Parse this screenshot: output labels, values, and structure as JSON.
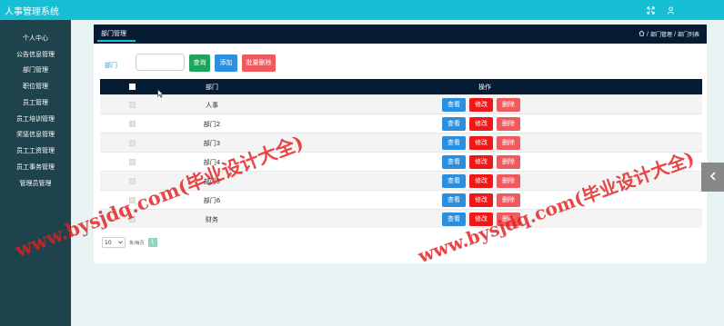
{
  "app": {
    "title": "人事管理系统"
  },
  "topbar": {
    "fullscreen_icon": "expand-icon",
    "user_icon": "user-icon"
  },
  "sidebar": {
    "items": [
      {
        "label": "个人中心"
      },
      {
        "label": "公告信息管理"
      },
      {
        "label": "部门管理"
      },
      {
        "label": "职位管理"
      },
      {
        "label": "员工管理"
      },
      {
        "label": "员工培训管理"
      },
      {
        "label": "奖惩信息管理"
      },
      {
        "label": "员工工资管理"
      },
      {
        "label": "员工事务管理"
      },
      {
        "label": "管理员管理"
      }
    ]
  },
  "panel": {
    "title": "部门管理",
    "breadcrumb": {
      "home_icon": "home-icon",
      "separator": "/",
      "level1": "部门管理",
      "level2": "部门列表"
    }
  },
  "filter": {
    "label": "部门",
    "input_value": "",
    "query_label": "查询",
    "add_label": "添加",
    "batch_delete_label": "批量删除"
  },
  "table": {
    "column_name": "部门",
    "column_action": "操作",
    "view_label": "查看",
    "edit_label": "修改",
    "delete_label": "删除",
    "rows": [
      {
        "name": "人事"
      },
      {
        "name": "部门2"
      },
      {
        "name": "部门3"
      },
      {
        "name": "部门4"
      },
      {
        "name": "部门5"
      },
      {
        "name": "部门6"
      },
      {
        "name": "财务"
      }
    ]
  },
  "pager": {
    "page_size": "10",
    "text": "条/每页",
    "current_page": "1"
  },
  "watermark": {
    "text": "www.bysjdq.com(毕业设计大全)",
    "color": "#e21e1e"
  },
  "colors": {
    "topbar": "#16bfd3",
    "sidebar": "#1f434d",
    "header": "#061c33",
    "view": "#2b8fde",
    "edit": "#ef1818",
    "delete": "#ef5a5f"
  }
}
